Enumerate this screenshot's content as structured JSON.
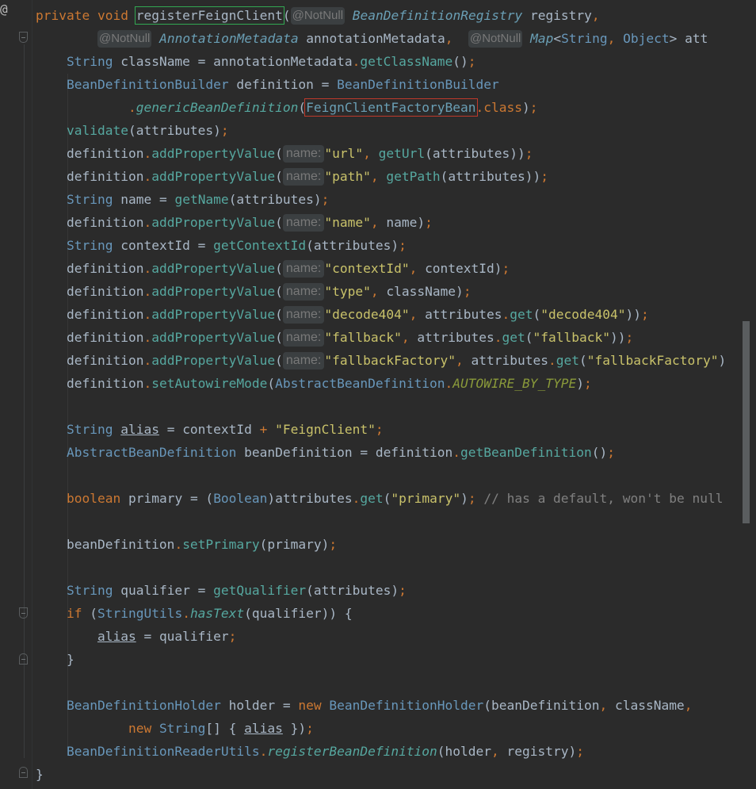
{
  "editor": {
    "gutter_marker": "@",
    "lines": [
      [
        [
          "kw",
          "private void "
        ],
        [
          "boxg",
          "registerFeignClient"
        ],
        [
          "p",
          "("
        ],
        [
          "hint",
          "@NotNull"
        ],
        [
          "tyi",
          " BeanDefinitionRegistry"
        ],
        [
          "p",
          " registry"
        ],
        [
          "kw",
          ","
        ]
      ],
      [
        [
          "p",
          "        "
        ],
        [
          "hint",
          "@NotNull"
        ],
        [
          "tyi",
          " AnnotationMetadata"
        ],
        [
          "p",
          " annotationMetadata"
        ],
        [
          "kw",
          ",  "
        ],
        [
          "hint",
          "@NotNull"
        ],
        [
          "tyi",
          " Map"
        ],
        [
          "p",
          "<"
        ],
        [
          "ty",
          "String"
        ],
        [
          "kw",
          ", "
        ],
        [
          "ty",
          "Object"
        ],
        [
          "p",
          "> att"
        ]
      ],
      [
        [
          "p",
          "    "
        ],
        [
          "ty",
          "String"
        ],
        [
          "p",
          " className "
        ],
        [
          "p",
          "= annotationMetadata"
        ],
        [
          "kw",
          "."
        ],
        [
          "mt",
          "getClassName"
        ],
        [
          "p",
          "()"
        ],
        [
          "kw",
          ";"
        ]
      ],
      [
        [
          "p",
          "    "
        ],
        [
          "ty",
          "BeanDefinitionBuilder"
        ],
        [
          "p",
          " definition "
        ],
        [
          "p",
          "= "
        ],
        [
          "ty",
          "BeanDefinitionBuilder"
        ]
      ],
      [
        [
          "p",
          "            "
        ],
        [
          "kw",
          "."
        ],
        [
          "mti",
          "genericBeanDefinition"
        ],
        [
          "p",
          "("
        ],
        [
          "boxr",
          "FeignClientFactoryBean"
        ],
        [
          "kw",
          ".class"
        ],
        [
          "p",
          ")"
        ],
        [
          "kw",
          ";"
        ]
      ],
      [
        [
          "p",
          "    "
        ],
        [
          "mt",
          "validate"
        ],
        [
          "p",
          "(attributes)"
        ],
        [
          "kw",
          ";"
        ]
      ],
      [
        [
          "p",
          "    definition"
        ],
        [
          "kw",
          "."
        ],
        [
          "mt",
          "addPropertyValue"
        ],
        [
          "p",
          "("
        ],
        [
          "hintn",
          "name:"
        ],
        [
          "str",
          "\"url\""
        ],
        [
          "kw",
          ", "
        ],
        [
          "mt",
          "getUrl"
        ],
        [
          "p",
          "(attributes))"
        ],
        [
          "kw",
          ";"
        ]
      ],
      [
        [
          "p",
          "    definition"
        ],
        [
          "kw",
          "."
        ],
        [
          "mt",
          "addPropertyValue"
        ],
        [
          "p",
          "("
        ],
        [
          "hintn",
          "name:"
        ],
        [
          "str",
          "\"path\""
        ],
        [
          "kw",
          ", "
        ],
        [
          "mt",
          "getPath"
        ],
        [
          "p",
          "(attributes))"
        ],
        [
          "kw",
          ";"
        ]
      ],
      [
        [
          "p",
          "    "
        ],
        [
          "ty",
          "String"
        ],
        [
          "p",
          " name "
        ],
        [
          "p",
          "= "
        ],
        [
          "mt",
          "getName"
        ],
        [
          "p",
          "(attributes)"
        ],
        [
          "kw",
          ";"
        ]
      ],
      [
        [
          "p",
          "    definition"
        ],
        [
          "kw",
          "."
        ],
        [
          "mt",
          "addPropertyValue"
        ],
        [
          "p",
          "("
        ],
        [
          "hintn",
          "name:"
        ],
        [
          "str",
          "\"name\""
        ],
        [
          "kw",
          ", "
        ],
        [
          "p",
          "name)"
        ],
        [
          "kw",
          ";"
        ]
      ],
      [
        [
          "p",
          "    "
        ],
        [
          "ty",
          "String"
        ],
        [
          "p",
          " contextId "
        ],
        [
          "p",
          "= "
        ],
        [
          "mt",
          "getContextId"
        ],
        [
          "p",
          "(attributes)"
        ],
        [
          "kw",
          ";"
        ]
      ],
      [
        [
          "p",
          "    definition"
        ],
        [
          "kw",
          "."
        ],
        [
          "mt",
          "addPropertyValue"
        ],
        [
          "p",
          "("
        ],
        [
          "hintn",
          "name:"
        ],
        [
          "str",
          "\"contextId\""
        ],
        [
          "kw",
          ", "
        ],
        [
          "p",
          "contextId)"
        ],
        [
          "kw",
          ";"
        ]
      ],
      [
        [
          "p",
          "    definition"
        ],
        [
          "kw",
          "."
        ],
        [
          "mt",
          "addPropertyValue"
        ],
        [
          "p",
          "("
        ],
        [
          "hintn",
          "name:"
        ],
        [
          "str",
          "\"type\""
        ],
        [
          "kw",
          ", "
        ],
        [
          "p",
          "className)"
        ],
        [
          "kw",
          ";"
        ]
      ],
      [
        [
          "p",
          "    definition"
        ],
        [
          "kw",
          "."
        ],
        [
          "mt",
          "addPropertyValue"
        ],
        [
          "p",
          "("
        ],
        [
          "hintn",
          "name:"
        ],
        [
          "str",
          "\"decode404\""
        ],
        [
          "kw",
          ", "
        ],
        [
          "p",
          "attributes"
        ],
        [
          "kw",
          "."
        ],
        [
          "mt",
          "get"
        ],
        [
          "p",
          "("
        ],
        [
          "str",
          "\"decode404\""
        ],
        [
          "p",
          "))"
        ],
        [
          "kw",
          ";"
        ]
      ],
      [
        [
          "p",
          "    definition"
        ],
        [
          "kw",
          "."
        ],
        [
          "mt",
          "addPropertyValue"
        ],
        [
          "p",
          "("
        ],
        [
          "hintn",
          "name:"
        ],
        [
          "str",
          "\"fallback\""
        ],
        [
          "kw",
          ", "
        ],
        [
          "p",
          "attributes"
        ],
        [
          "kw",
          "."
        ],
        [
          "mt",
          "get"
        ],
        [
          "p",
          "("
        ],
        [
          "str",
          "\"fallback\""
        ],
        [
          "p",
          "))"
        ],
        [
          "kw",
          ";"
        ]
      ],
      [
        [
          "p",
          "    definition"
        ],
        [
          "kw",
          "."
        ],
        [
          "mt",
          "addPropertyValue"
        ],
        [
          "p",
          "("
        ],
        [
          "hintn",
          "name:"
        ],
        [
          "str",
          "\"fallbackFactory\""
        ],
        [
          "kw",
          ", "
        ],
        [
          "p",
          "attributes"
        ],
        [
          "kw",
          "."
        ],
        [
          "mt",
          "get"
        ],
        [
          "p",
          "("
        ],
        [
          "str",
          "\"fallbackFactory\""
        ],
        [
          "p",
          ")"
        ]
      ],
      [
        [
          "p",
          "    definition"
        ],
        [
          "kw",
          "."
        ],
        [
          "mt",
          "setAutowireMode"
        ],
        [
          "p",
          "("
        ],
        [
          "ty",
          "AbstractBeanDefinition"
        ],
        [
          "kw",
          "."
        ],
        [
          "constg",
          "AUTOWIRE_BY_TYPE"
        ],
        [
          "p",
          ")"
        ],
        [
          "kw",
          ";"
        ]
      ],
      [],
      [
        [
          "p",
          "    "
        ],
        [
          "ty",
          "String"
        ],
        [
          "p",
          " "
        ],
        [
          "ul",
          "alias"
        ],
        [
          "p",
          " = contextId "
        ],
        [
          "kw",
          "+ "
        ],
        [
          "str",
          "\"FeignClient\""
        ],
        [
          "kw",
          ";"
        ]
      ],
      [
        [
          "p",
          "    "
        ],
        [
          "ty",
          "AbstractBeanDefinition"
        ],
        [
          "p",
          " beanDefinition "
        ],
        [
          "p",
          "= definition"
        ],
        [
          "kw",
          "."
        ],
        [
          "mt",
          "getBeanDefinition"
        ],
        [
          "p",
          "()"
        ],
        [
          "kw",
          ";"
        ]
      ],
      [],
      [
        [
          "p",
          "    "
        ],
        [
          "kw",
          "boolean"
        ],
        [
          "p",
          " primary "
        ],
        [
          "p",
          "= ("
        ],
        [
          "ty",
          "Boolean"
        ],
        [
          "p",
          ")attributes"
        ],
        [
          "kw",
          "."
        ],
        [
          "mt",
          "get"
        ],
        [
          "p",
          "("
        ],
        [
          "str",
          "\"primary\""
        ],
        [
          "p",
          ")"
        ],
        [
          "kw",
          "; "
        ],
        [
          "cmt",
          "// has a default, won't be null"
        ]
      ],
      [],
      [
        [
          "p",
          "    beanDefinition"
        ],
        [
          "kw",
          "."
        ],
        [
          "mt",
          "setPrimary"
        ],
        [
          "p",
          "(primary)"
        ],
        [
          "kw",
          ";"
        ]
      ],
      [],
      [
        [
          "p",
          "    "
        ],
        [
          "ty",
          "String"
        ],
        [
          "p",
          " qualifier "
        ],
        [
          "p",
          "= "
        ],
        [
          "mt",
          "getQualifier"
        ],
        [
          "p",
          "(attributes)"
        ],
        [
          "kw",
          ";"
        ]
      ],
      [
        [
          "p",
          "    "
        ],
        [
          "kw",
          "if "
        ],
        [
          "p",
          "("
        ],
        [
          "ty",
          "StringUtils"
        ],
        [
          "kw",
          "."
        ],
        [
          "ii",
          "hasText"
        ],
        [
          "p",
          "(qualifier)) {"
        ]
      ],
      [
        [
          "p",
          "        "
        ],
        [
          "ul",
          "alias"
        ],
        [
          "p",
          " = qualifier"
        ],
        [
          "kw",
          ";"
        ]
      ],
      [
        [
          "p",
          "    }"
        ]
      ],
      [],
      [
        [
          "p",
          "    "
        ],
        [
          "ty",
          "BeanDefinitionHolder"
        ],
        [
          "p",
          " holder "
        ],
        [
          "p",
          "= "
        ],
        [
          "kw",
          "new "
        ],
        [
          "ty",
          "BeanDefinitionHolder"
        ],
        [
          "p",
          "(beanDefinition"
        ],
        [
          "kw",
          ", "
        ],
        [
          "p",
          "className"
        ],
        [
          "kw",
          ","
        ]
      ],
      [
        [
          "p",
          "            "
        ],
        [
          "kw",
          "new "
        ],
        [
          "ty",
          "String"
        ],
        [
          "p",
          "[] { "
        ],
        [
          "ul",
          "alias"
        ],
        [
          "p",
          " })"
        ],
        [
          "kw",
          ";"
        ]
      ],
      [
        [
          "p",
          "    "
        ],
        [
          "ty",
          "BeanDefinitionReaderUtils"
        ],
        [
          "kw",
          "."
        ],
        [
          "ii",
          "registerBeanDefinition"
        ],
        [
          "p",
          "(holder"
        ],
        [
          "kw",
          ", "
        ],
        [
          "p",
          "registry)"
        ],
        [
          "kw",
          ";"
        ]
      ],
      [
        [
          "p",
          "}"
        ]
      ]
    ]
  }
}
